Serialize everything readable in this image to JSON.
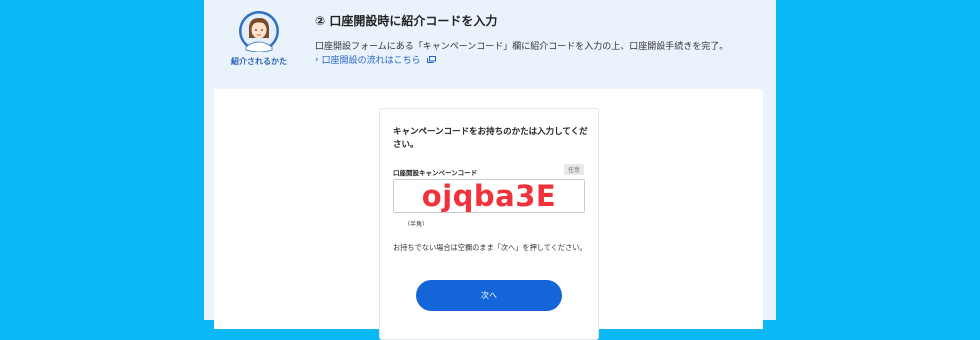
{
  "step": {
    "title": "② 口座開設時に紹介コードを入力",
    "description": "口座開設フォームにある「キャンペーンコード」欄に紹介コードを入力の上、口座開設手続きを完了。",
    "flow_link": "口座開設の流れはこちら",
    "avatar_caption": "紹介されるかた",
    "icons": [
      "person-avatar-icon",
      "chevron-right-icon",
      "external-window-icon"
    ]
  },
  "form": {
    "heading": "キャンペーンコードをお持ちのかたは入力してください。",
    "field_label": "口座開設キャンペーンコード",
    "optional_badge": "任意",
    "code_value": "ojqba3E",
    "width_note": "（半角）",
    "note": "お持ちでない場合は空欄のまま「次へ」を押してください。",
    "next_button": "次へ"
  },
  "colors": {
    "outer_background": "#0ab8f5",
    "frame_background": "#eaf2fb",
    "accent_blue": "#1466d8",
    "link_blue": "#1f63c6",
    "code_red": "#f2323a"
  }
}
